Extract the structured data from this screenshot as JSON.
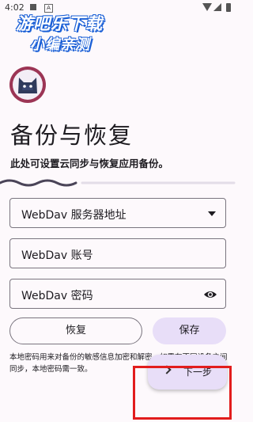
{
  "status_bar": {
    "time": "4:02",
    "icon_a": "A"
  },
  "watermark": {
    "line1": "游吧乐下载",
    "line2": "小编亲测"
  },
  "page": {
    "title": "备份与恢复",
    "subtitle": "此处可设置云同步与恢复应用备份。"
  },
  "progress": {
    "fraction": 0.33
  },
  "fields": {
    "server": {
      "label": "WebDav 服务器地址"
    },
    "account": {
      "label": "WebDav 账号"
    },
    "password": {
      "label": "WebDav 密码"
    }
  },
  "buttons": {
    "restore": "恢复",
    "save": "保存",
    "next": "下一步"
  },
  "note": "本地密码用来对备份的敏感信息加密和解密，如需在不同设备之间同步，本地密码需一致。",
  "colors": {
    "accent": "#e8def8",
    "avatar_ring": "#9c3555",
    "highlight": "#e21d1d"
  },
  "icons": [
    "dropdown-arrow-icon",
    "eye-icon",
    "chevron-right-icon"
  ]
}
